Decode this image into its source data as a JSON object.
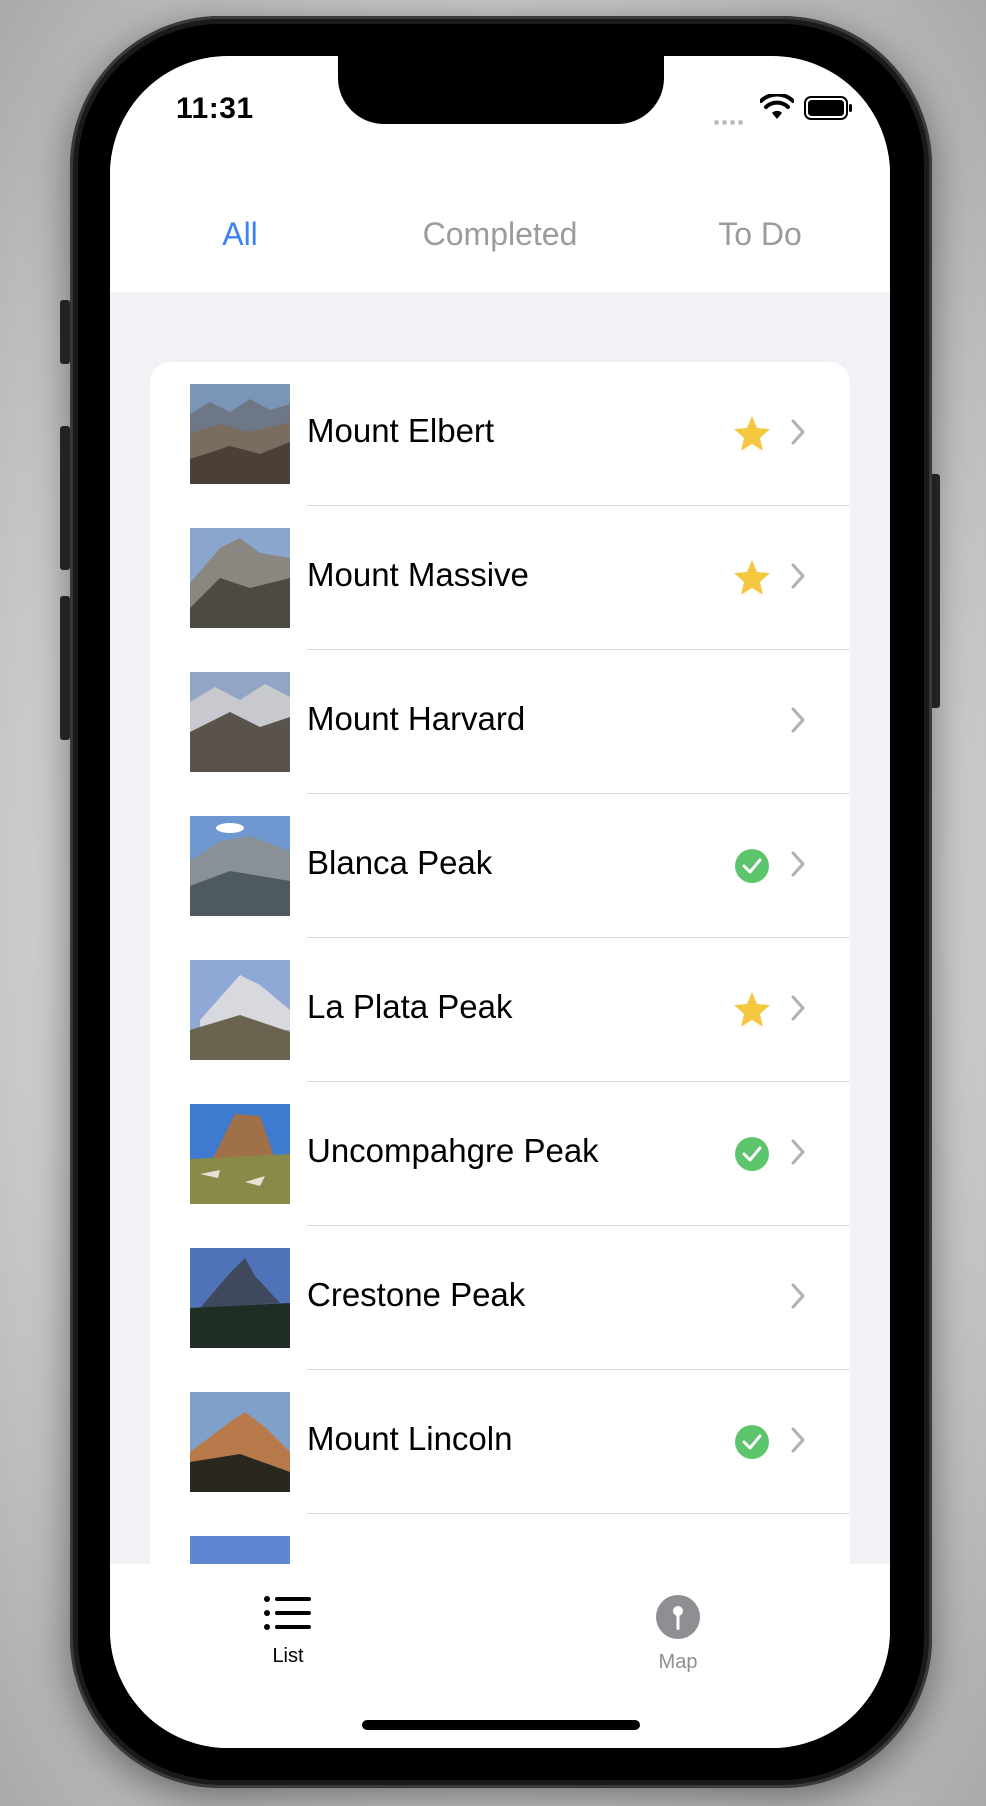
{
  "status_bar": {
    "time": "11:31"
  },
  "segments": {
    "all": "All",
    "completed": "Completed",
    "todo": "To Do",
    "active_color": "#3a83f0",
    "inactive_color": "#9b9b9b"
  },
  "peaks": [
    {
      "name": "Mount Elbert",
      "status": "star"
    },
    {
      "name": "Mount Massive",
      "status": "star"
    },
    {
      "name": "Mount Harvard",
      "status": "none"
    },
    {
      "name": "Blanca Peak",
      "status": "check"
    },
    {
      "name": "La Plata Peak",
      "status": "star"
    },
    {
      "name": "Uncompahgre Peak",
      "status": "check"
    },
    {
      "name": "Crestone Peak",
      "status": "none"
    },
    {
      "name": "Mount Lincoln",
      "status": "check"
    },
    {
      "name": "",
      "status": "none"
    }
  ],
  "icons": {
    "star": "star-icon",
    "check": "checkmark-circle-icon",
    "chevron": "chevron-right-icon"
  },
  "colors": {
    "star": "#f5c842",
    "check": "#5cc46b",
    "chevron": "#b0b0b5"
  },
  "tab_bar": {
    "list_label": "List",
    "map_label": "Map"
  }
}
